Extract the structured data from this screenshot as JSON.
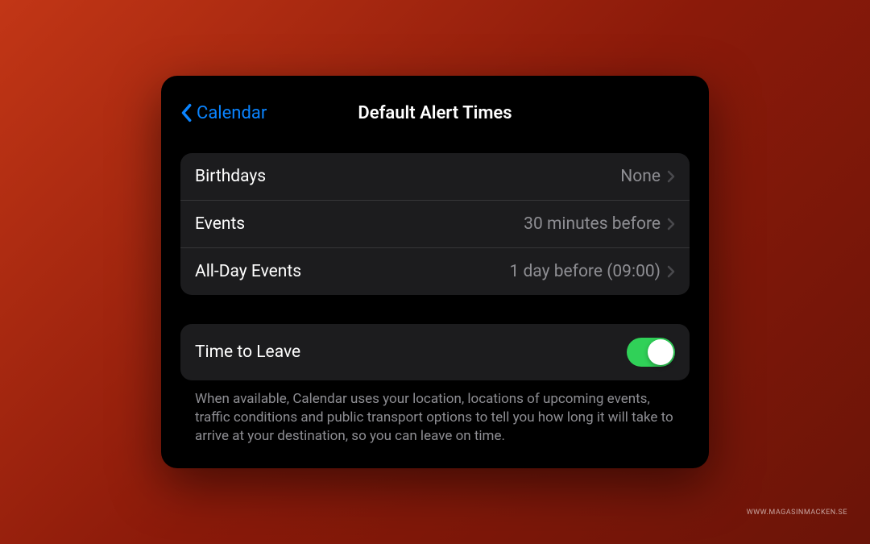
{
  "header": {
    "back_label": "Calendar",
    "title": "Default Alert Times"
  },
  "section1": {
    "rows": [
      {
        "label": "Birthdays",
        "value": "None"
      },
      {
        "label": "Events",
        "value": "30 minutes before"
      },
      {
        "label": "All-Day Events",
        "value": "1 day before (09:00)"
      }
    ]
  },
  "section2": {
    "row": {
      "label": "Time to Leave",
      "toggle_on": true
    },
    "footer": "When available, Calendar uses your location, locations of upcoming events, traffic conditions and public transport options to tell you how long it will take to arrive at your destination, so you can leave on time."
  },
  "watermark": "WWW.MAGASINMACKEN.SE",
  "colors": {
    "accent": "#0a84ff",
    "toggle_on": "#30d158",
    "panel_bg": "#000000",
    "section_bg": "#1c1c1e",
    "text_primary": "#ffffff",
    "text_secondary": "#8e8e93"
  }
}
